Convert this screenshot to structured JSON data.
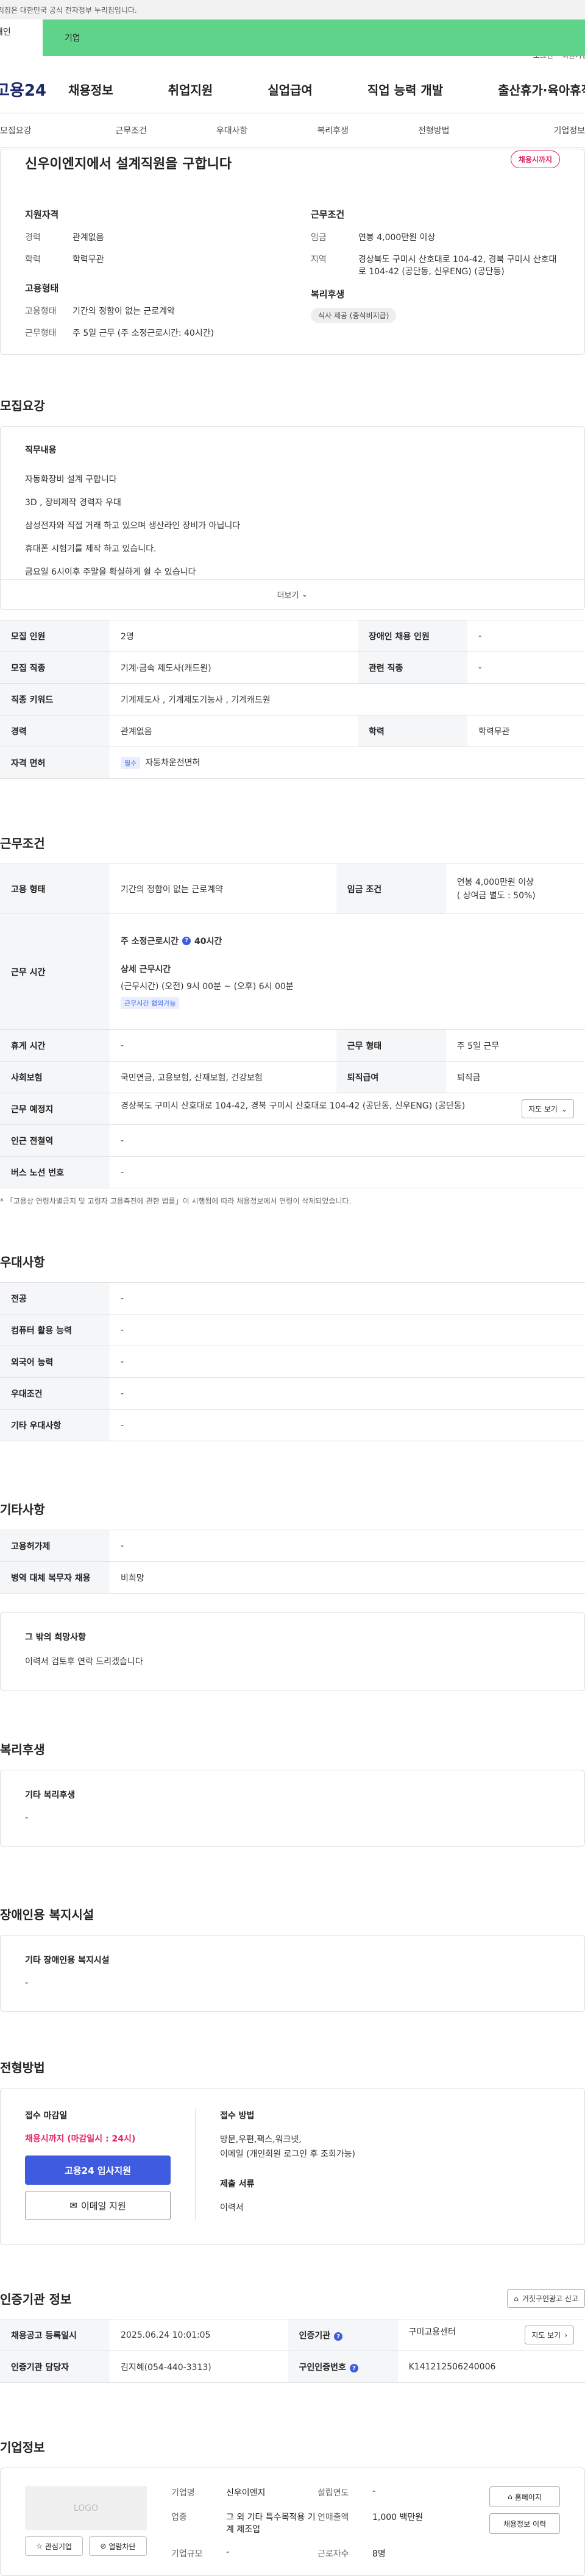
{
  "gov_bar": "이 누리집은 대한민국 공식 전자정부 누리집입니다.",
  "user_tabs": {
    "person": "개인",
    "company": "기업"
  },
  "util": {
    "login": "로그인",
    "signup": "회원가입"
  },
  "logo": "고용24",
  "gnb": [
    "채용정보",
    "취업지원",
    "실업급여",
    "직업 능력 개발",
    "출산휴가·육아휴직"
  ],
  "subnav": [
    "모집요강",
    "근무조건",
    "우대사항",
    "복리후생",
    "전형방법",
    "기업정보"
  ],
  "summary": {
    "title": "신우이엔지에서 설계직원을 구합니다",
    "badge": "채용시까지",
    "qual_title": "지원자격",
    "career_k": "경력",
    "career_v": "관계없음",
    "edu_k": "학력",
    "edu_v": "학력무관",
    "emp_title": "고용형태",
    "emptype_k": "고용형태",
    "emptype_v": "기간의 정함이 없는 근로계약",
    "worktype_k": "근무형태",
    "worktype_v": "주 5일 근무 (주 소정근로시간: 40시간)",
    "cond_title": "근무조건",
    "wage_k": "임금",
    "wage_v": "연봉 4,000만원 이상",
    "area_k": "지역",
    "area_v": "경상북도 구미시 산호대로 104-42, 경북 구미시 산호대로 104-42 (공단동, 신우ENG) (공단동)",
    "welfare_title": "복리후생",
    "welfare_chip": "식사 제공 (중식비지급)"
  },
  "recruit": {
    "section": "모집요강",
    "duty_title": "직무내용",
    "duty_lines": [
      "자동화장비 설계 구합니다",
      "3D , 장비제작 경력자 우대",
      "삼성전자와 직접 거래 하고 있으며 생산라인 장비가 아닙니다",
      "휴대폰 시험기를 제작 하고 있습니다.",
      "금요일 6시이후 주말을 확실하게 쉴 수 있습니다"
    ],
    "more": "더보기",
    "rows": {
      "headcount_k": "모집 인원",
      "headcount_v": "2명",
      "disabled_k": "장애인 채용 인원",
      "disabled_v": "-",
      "job_k": "모집 직종",
      "job_v": "기계·금속 제도사(캐드원)",
      "related_k": "관련 직종",
      "related_v": "-",
      "keyword_k": "직종 키워드",
      "keyword_v": "기계제도사 , 기계제도기능사 , 기계캐드원",
      "career_k": "경력",
      "career_v": "관계없음",
      "edu_k": "학력",
      "edu_v": "학력무관",
      "license_k": "자격 면허",
      "license_badge": "필수",
      "license_v": "자동차운전면허"
    }
  },
  "conditions": {
    "section": "근무조건",
    "emptype_k": "고용 형태",
    "emptype_v": "기간의 정함이 없는 근로계약",
    "wage_k": "임금 조건",
    "wage_v1": "연봉 4,000만원 이상",
    "wage_v2": "( 상여금 별도 : 50%)",
    "hours_k": "근무 시간",
    "hours_title": "주 소정근로시간",
    "hours_v": "40시간",
    "hours_detail_title": "상세 근무시간",
    "hours_detail": "(근무시간) (오전) 9시 00분 ~ (오후) 6시 00분",
    "hours_badge": "근무시간 협의가능",
    "break_k": "휴게 시간",
    "break_v": "-",
    "worktype_k": "근무 형태",
    "worktype_v": "주 5일 근무",
    "insurance_k": "사회보험",
    "insurance_v": "국민연금, 고용보험, 산재보험, 건강보험",
    "retire_k": "퇴직급여",
    "retire_v": "퇴직금",
    "place_k": "근무 예정지",
    "place_v": "경상북도 구미시 산호대로 104-42, 경북 구미시 산호대로 104-42 (공단동, 신우ENG) (공단동)",
    "map_btn": "지도 보기",
    "subway_k": "인근 전철역",
    "subway_v": "-",
    "bus_k": "버스 노선 번호",
    "bus_v": "-",
    "note": "* 「고용상 연령차별금지 및 고령자 고용촉진에 관한 법률」이 시행됨에 따라 채용정보에서 연령이 삭제되었습니다."
  },
  "preference": {
    "section": "우대사항",
    "rows": [
      {
        "k": "전공",
        "v": "-"
      },
      {
        "k": "컴퓨터 활용 능력",
        "v": "-"
      },
      {
        "k": "외국어 능력",
        "v": "-"
      },
      {
        "k": "우대조건",
        "v": "-"
      },
      {
        "k": "기타 우대사항",
        "v": "-"
      }
    ]
  },
  "etc": {
    "section": "기타사항",
    "disabled_k": "고용허가제",
    "disabled_v": "-",
    "military_k": "병역 대체 복무자 채용",
    "military_v": "비희망",
    "wish_title": "그 밖의 희망사항",
    "wish_v": "이력서 검토후 연락 드리겠습니다"
  },
  "welfare": {
    "section": "복리후생",
    "title": "기타 복리후생",
    "v": "-"
  },
  "facility": {
    "section": "장애인용 복지시설",
    "title": "기타 장애인용 복지시설",
    "v": "-"
  },
  "process": {
    "section": "전형방법",
    "deadline_title": "접수 마감일",
    "deadline": "채용시까지 (마감일시 : 24시)",
    "apply_btn": "고용24 입사지원",
    "email_btn": "이메일 지원",
    "method_title": "접수 방법",
    "method_v1": "방문,우편,팩스,워크넷,",
    "method_v2": "이메일 (개인회원 로그인 후 조회가능)",
    "docs_title": "제출 서류",
    "docs_v": "이력서"
  },
  "cert": {
    "section": "인증기관 정보",
    "false_btn": "거짓구인광고 신고",
    "reg_k": "채용공고 등록일시",
    "reg_v": "2025.06.24 10:01:05",
    "agency_k": "인증기관",
    "agency_v": "구미고용센터",
    "map_btn": "지도 보기",
    "staff_k": "인증기관 담당자",
    "staff_v": "김지혜(054-440-3313)",
    "no_k": "구인인증번호",
    "no_v": "K141212506240006"
  },
  "company": {
    "section": "기업정보",
    "logo": "LOGO",
    "fav_btn": "관심기업",
    "block_btn": "열람차단",
    "name_k": "기업명",
    "name_v": "신우이엔지",
    "year_k": "설립연도",
    "year_v": "-",
    "ind_k": "업종",
    "ind_v": "그 외 기타 특수목적용 기계 제조업",
    "sales_k": "연매출액",
    "sales_v": "1,000 백만원",
    "emp_k": "근로자수",
    "emp_v": "8명",
    "size_k": "기업규모",
    "size_v": "-",
    "home_btn": "홈페이지",
    "history_btn": "채용정보 이력"
  }
}
